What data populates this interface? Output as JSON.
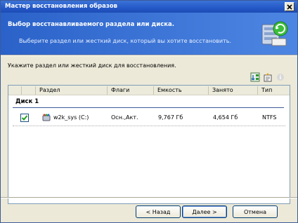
{
  "window": {
    "title": "Мастер восстановления образов"
  },
  "header": {
    "title": "Выбор восстанавливаемого раздела или диска.",
    "subtitle": "Выберите раздел или жесткий диск, который вы хотите восстановить."
  },
  "prompt": "Укажите раздел или жесткий диск для восстановления.",
  "table": {
    "columns": [
      "Раздел",
      "Флаги",
      "Емкость",
      "Занято",
      "Тип"
    ],
    "groups": [
      {
        "label": "Диск 1",
        "rows": [
          {
            "checked": true,
            "partition": "w2k_sys (C:)",
            "flags": "Осн.,Акт.",
            "capacity": "9,767 Гб",
            "used": "4,654 Гб",
            "type": "NTFS"
          }
        ]
      }
    ]
  },
  "buttons": {
    "back": "< Назад",
    "next": "Далее >",
    "cancel": "Отмена"
  },
  "colors": {
    "title_bar": "#2559c7",
    "header_bg": "#2a62c9",
    "dialog_bg": "#ece9d8"
  }
}
